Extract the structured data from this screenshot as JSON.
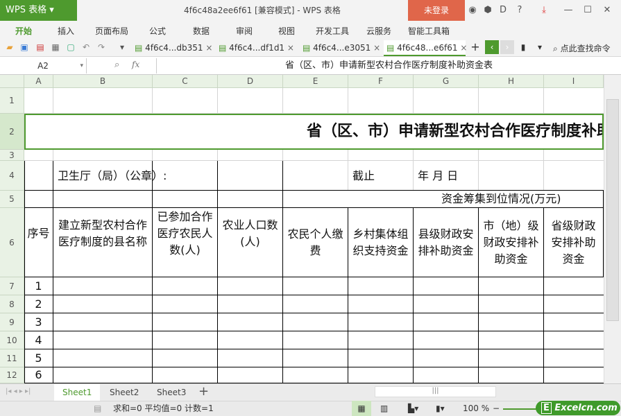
{
  "app": {
    "logo": "WPS 表格",
    "title": "4f6c48a2ee6f61 [兼容模式] - WPS 表格",
    "login": "未登录"
  },
  "menu": [
    "开始",
    "插入",
    "页面布局",
    "公式",
    "数据",
    "审阅",
    "视图",
    "开发工具",
    "云服务",
    "智能工具箱"
  ],
  "doc_tabs": [
    {
      "label": "4f6c4...db351"
    },
    {
      "label": "4f6c4...df1d1"
    },
    {
      "label": "4f6c4...e3051"
    },
    {
      "label": "4f6c48...e6f61",
      "active": true
    }
  ],
  "search_cmd": "点此查找命令",
  "formula_bar": {
    "name_box": "A2",
    "fx": "fx",
    "value": "省（区、市）申请新型农村合作医疗制度补助资金表"
  },
  "columns": [
    "A",
    "B",
    "C",
    "D",
    "E",
    "F",
    "G",
    "H",
    "I"
  ],
  "rows": [
    "1",
    "2",
    "3",
    "4",
    "5",
    "6",
    "7",
    "8",
    "9",
    "10",
    "11",
    "12"
  ],
  "cells": [
    {
      "c": 0,
      "r": 1,
      "cs": 9,
      "rs": 1,
      "t": "省（区、市）申请新型农村合作医疗制度补助资金表",
      "title": true
    },
    {
      "c": 1,
      "r": 3,
      "cs": 2,
      "rs": 1,
      "t": "卫生厅（局）（公章）:",
      "left": true
    },
    {
      "c": 5,
      "r": 3,
      "cs": 1,
      "rs": 1,
      "t": "截止",
      "left": true
    },
    {
      "c": 6,
      "r": 3,
      "cs": 1,
      "rs": 1,
      "t": "年  月  日",
      "left": true
    },
    {
      "c": 0,
      "r": 4,
      "cs": 1,
      "rs": 2,
      "t": "序号"
    },
    {
      "c": 1,
      "r": 4,
      "cs": 1,
      "rs": 2,
      "t": "建立新型农村合作医疗制度的县名称"
    },
    {
      "c": 2,
      "r": 4,
      "cs": 1,
      "rs": 2,
      "t": "已参加合作医疗农民人数(人)"
    },
    {
      "c": 3,
      "r": 4,
      "cs": 1,
      "rs": 2,
      "t": "农业人口数(人)"
    },
    {
      "c": 4,
      "r": 4,
      "cs": 5,
      "rs": 1,
      "t": "资金筹集到位情况(万元)"
    },
    {
      "c": 4,
      "r": 5,
      "cs": 1,
      "rs": 1,
      "t": "农民个人缴费"
    },
    {
      "c": 5,
      "r": 5,
      "cs": 1,
      "rs": 1,
      "t": "乡村集体组织支持资金"
    },
    {
      "c": 6,
      "r": 5,
      "cs": 1,
      "rs": 1,
      "t": "县级财政安排补助资金"
    },
    {
      "c": 7,
      "r": 5,
      "cs": 1,
      "rs": 1,
      "t": "市（地）级财政安排补助资金"
    },
    {
      "c": 8,
      "r": 5,
      "cs": 1,
      "rs": 1,
      "t": "省级财政安排补助资金"
    },
    {
      "c": 0,
      "r": 6,
      "t": "1"
    },
    {
      "c": 0,
      "r": 7,
      "t": "2"
    },
    {
      "c": 0,
      "r": 8,
      "t": "3"
    },
    {
      "c": 0,
      "r": 9,
      "t": "4"
    },
    {
      "c": 0,
      "r": 10,
      "t": "5"
    },
    {
      "c": 0,
      "r": 11,
      "t": "6"
    }
  ],
  "sheets": [
    "Sheet1",
    "Sheet2",
    "Sheet3"
  ],
  "status": {
    "summary": "求和=0  平均值=0  计数=1",
    "zoom": "100 %",
    "watermark": "Excelcn.com"
  }
}
